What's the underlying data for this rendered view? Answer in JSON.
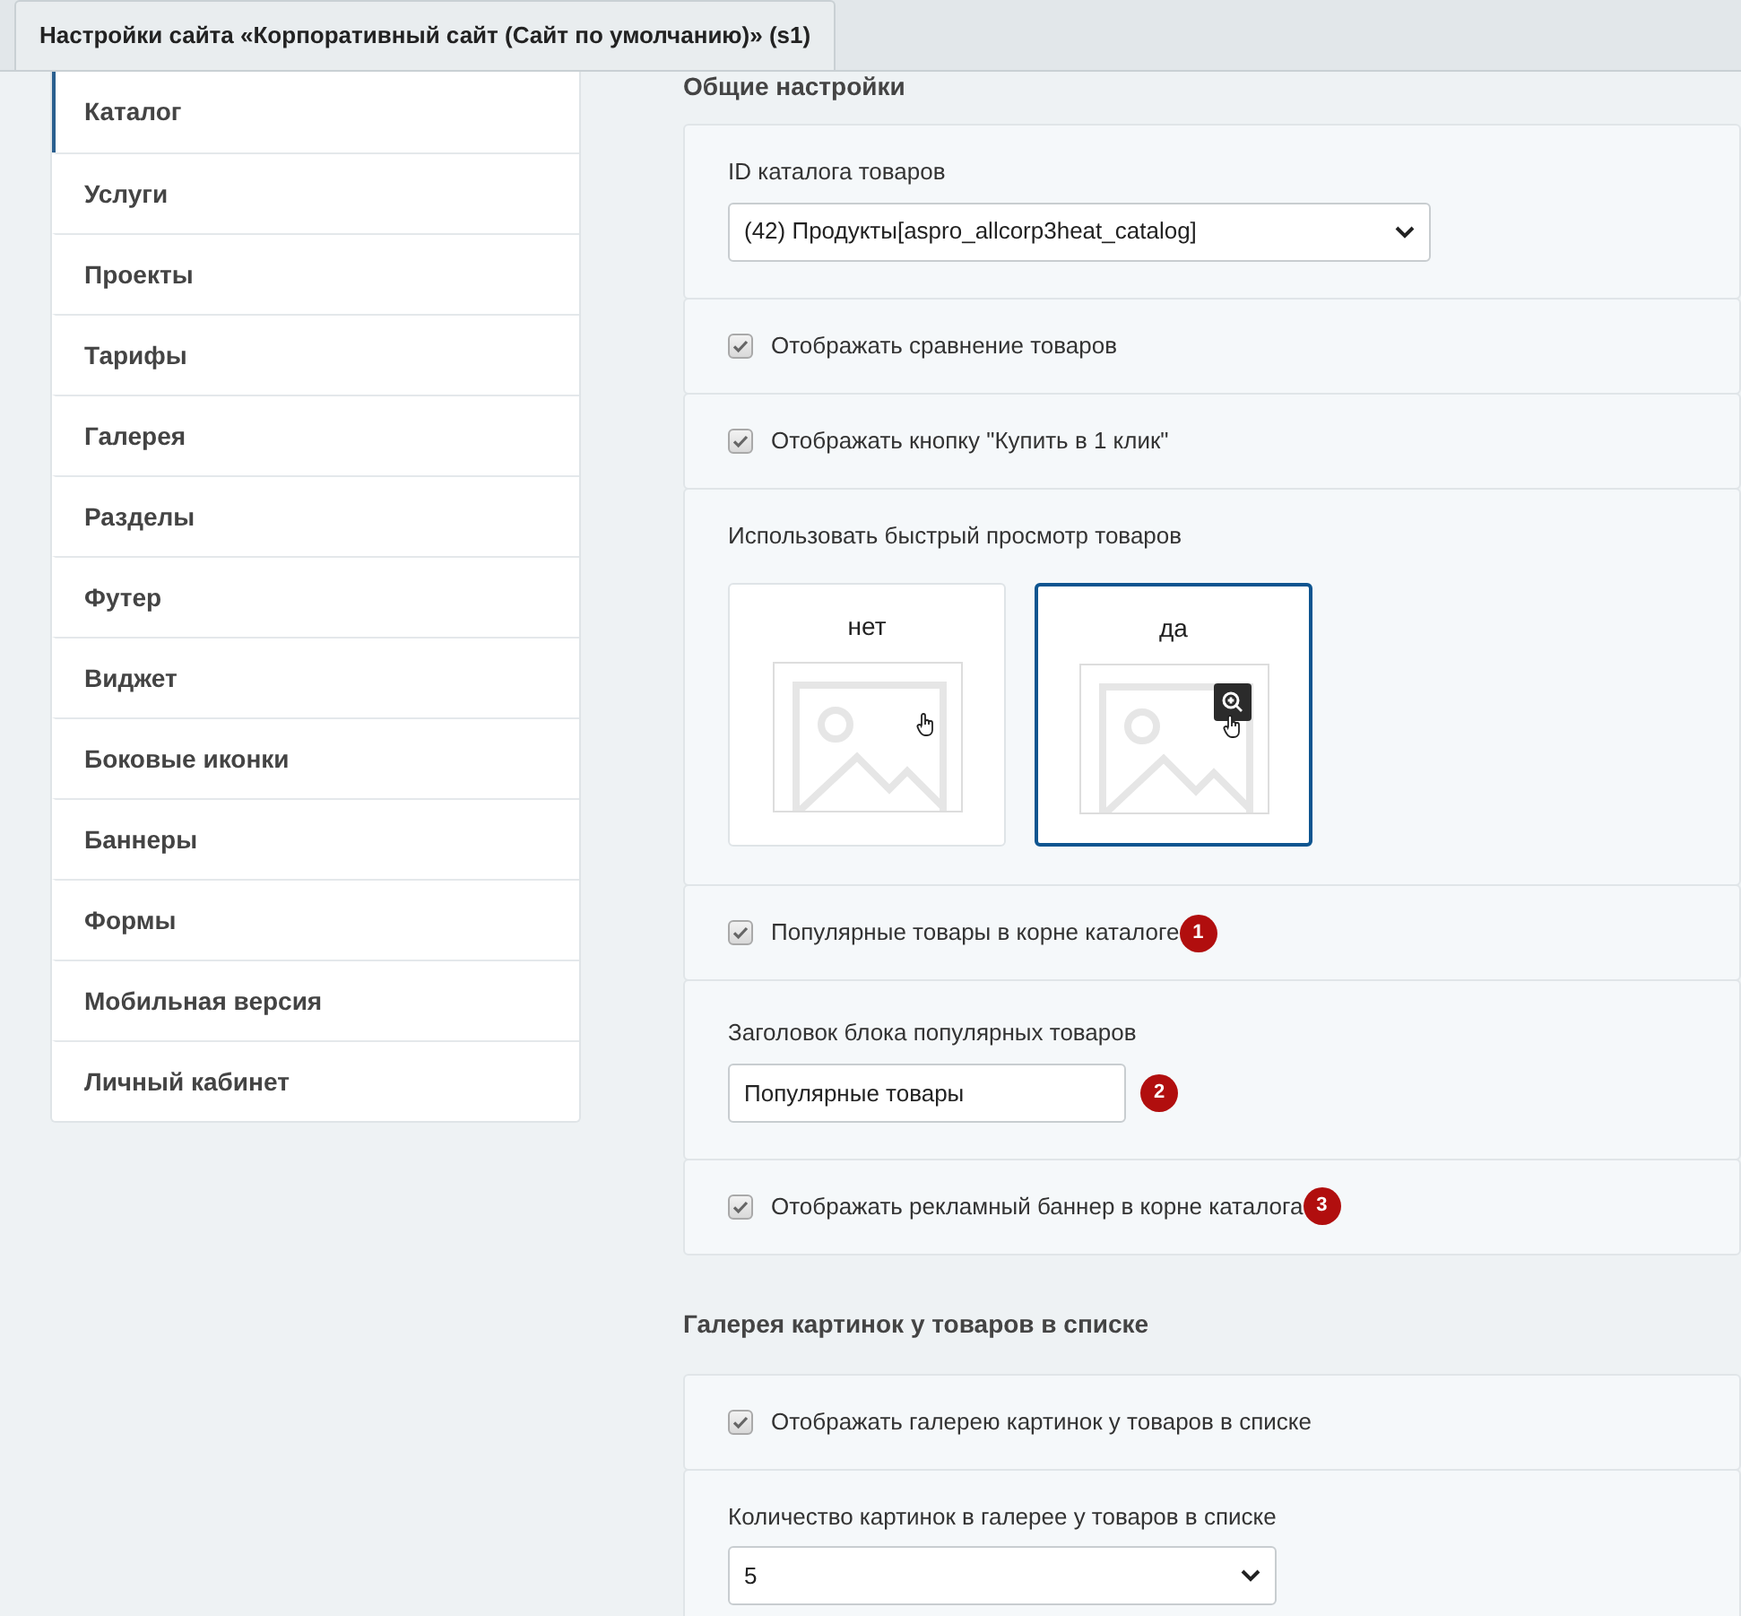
{
  "window": {
    "title": "Настройки сайта «Корпоративный сайт (Сайт по умолчанию)» (s1)"
  },
  "sidebar": {
    "items": [
      {
        "label": "Каталог",
        "selected": true
      },
      {
        "label": "Услуги",
        "selected": false
      },
      {
        "label": "Проекты",
        "selected": false
      },
      {
        "label": "Тарифы",
        "selected": false
      },
      {
        "label": "Галерея",
        "selected": false
      },
      {
        "label": "Разделы",
        "selected": false
      },
      {
        "label": "Футер",
        "selected": false
      },
      {
        "label": "Виджет",
        "selected": false
      },
      {
        "label": "Боковые иконки",
        "selected": false
      },
      {
        "label": "Баннеры",
        "selected": false
      },
      {
        "label": "Формы",
        "selected": false
      },
      {
        "label": "Мобильная версия",
        "selected": false
      },
      {
        "label": "Личный кабинет",
        "selected": false
      }
    ]
  },
  "sections": [
    {
      "title": "Общие настройки",
      "rows": [
        {
          "kind": "select",
          "label": "ID каталога товаров",
          "value": "(42) Продукты[aspro_allcorp3heat_catalog]"
        },
        {
          "kind": "checkbox",
          "label": "Отображать сравнение товаров",
          "checked": true
        },
        {
          "kind": "checkbox",
          "label": "Отображать кнопку \"Купить в 1 клик\"",
          "checked": true
        },
        {
          "kind": "choice",
          "label": "Использовать быстрый просмотр товаров",
          "options": [
            {
              "label": "нет",
              "selected": false
            },
            {
              "label": "да",
              "selected": true
            }
          ]
        },
        {
          "kind": "checkbox",
          "label": "Популярные товары в корне каталоге",
          "checked": true,
          "badge": "1"
        },
        {
          "kind": "text",
          "label": "Заголовок блока популярных товаров",
          "value": "Популярные товары",
          "badge": "2"
        },
        {
          "kind": "checkbox",
          "label": "Отображать рекламный баннер в корне каталога",
          "checked": true,
          "badge": "3"
        }
      ]
    },
    {
      "title": "Галерея картинок у товаров в списке",
      "rows": [
        {
          "kind": "checkbox",
          "label": "Отображать галерею картинок у товаров в списке",
          "checked": true
        },
        {
          "kind": "select",
          "label": "Количество картинок в галерее у товаров в списке",
          "value": "5"
        }
      ]
    }
  ]
}
